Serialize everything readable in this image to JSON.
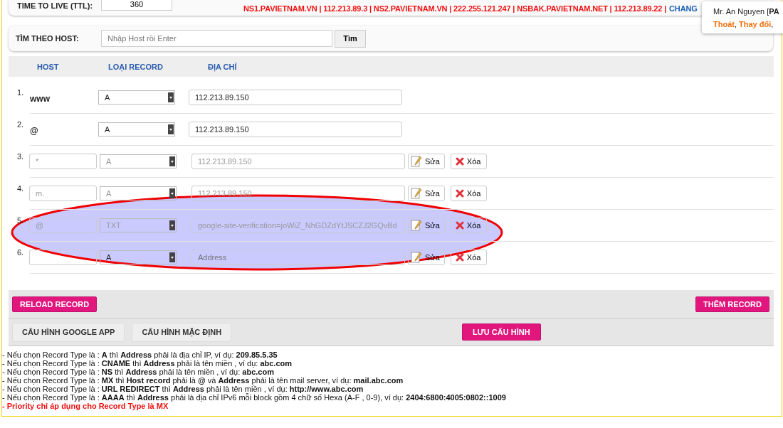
{
  "ttl": {
    "label": "TIME TO LIVE (TTL):",
    "value": "360"
  },
  "nameservers": "NS1.PAVIETNAM.VN | 112.213.89.3 | NS2.PAVIETNAM.VN | 222.255.121.247 | NSBAK.PAVIETNAM.NET | 112.213.89.22 |",
  "change_link": "CHANG",
  "user_popup": {
    "greeting": "Mr. An Nguyen [**PA**",
    "links": [
      {
        "label": "Thoát",
        "after": ","
      },
      {
        "label": "Thay đổi",
        "after": ","
      }
    ]
  },
  "search": {
    "label": "TÌM THEO HOST:",
    "placeholder": "Nhập Host rồi Enter",
    "button": "Tìm"
  },
  "table": {
    "columns": [
      "HOST",
      "LOẠI RECORD",
      "ĐỊA CHỈ"
    ],
    "rows": [
      {
        "kind": "fixed",
        "number": "1.",
        "host": "www",
        "type": "A",
        "address": "112.213.89.150"
      },
      {
        "kind": "fixed",
        "number": "2.",
        "host": "@",
        "type": "A",
        "address": "112.213.89.150"
      },
      {
        "kind": "editable",
        "number": "3.",
        "host": "*",
        "type": "A",
        "address": "112.213.89.150",
        "disabled": true,
        "edit": "Sửa",
        "delete": "Xóa"
      },
      {
        "kind": "editable",
        "number": "4.",
        "host": "m.",
        "type": "A",
        "address": "112.213.89.150",
        "disabled": true,
        "edit": "Sửa",
        "delete": "Xóa"
      },
      {
        "kind": "editable",
        "number": "5.",
        "host": "@",
        "type": "TXT",
        "address": "google-site-verification=joWiZ_NhGDZdYtJSCZJ2GQvBd",
        "disabled": true,
        "edit": "Sửa",
        "delete": "Xóa"
      },
      {
        "kind": "editable",
        "number": "6.",
        "host": "",
        "type": "A",
        "address_placeholder": "Address",
        "disabled": false,
        "edit": "Sửa",
        "delete": "Xóa"
      }
    ]
  },
  "toolbar": {
    "reload": "RELOAD RECORD",
    "add": "THÊM RECORD"
  },
  "config_bar": {
    "buttons": [
      "CẤU HÌNH GOOGLE APP",
      "CẤU HÌNH MẶC ĐỊNH"
    ],
    "save": "LƯU CẤU HÌNH"
  },
  "help": [
    {
      "kind": "info",
      "text": "- Nếu chọn Record Type là : **A** thì **Address** phải là địa chỉ IP, ví dụ: **209.85.5.35**"
    },
    {
      "kind": "info",
      "text": "- Nếu chọn Record Type là : **CNAME** thì **Address** phải là tên miền , ví dụ: **abc.com**"
    },
    {
      "kind": "info",
      "text": "- Nếu chọn Record Type là : **NS** thì **Address** phải là tên miền , ví dụ: **abc.com**"
    },
    {
      "kind": "info",
      "text": "- Nếu chọn Record Type là : **MX** thì **Host record** phải là **@** và **Address** phải là tên mail server, ví dụ: **mail.abc.com**"
    },
    {
      "kind": "info",
      "text": "- Nếu chọn Record Type là : **URL REDIRECT** thì **Address** phải là tên miền , ví dụ: **http://www.abc.com**"
    },
    {
      "kind": "info",
      "text": "- Nếu chọn Record Type là : **AAAA** thì **Address** phải là địa chỉ IPv6 mỗi block gồm 4 chữ số Hexa (A-F , 0-9), ví dụ: **2404:6800:4005:0802::1009**"
    },
    {
      "kind": "note",
      "text": "- Priority chỉ áp dụng cho Record Type là MX"
    }
  ]
}
